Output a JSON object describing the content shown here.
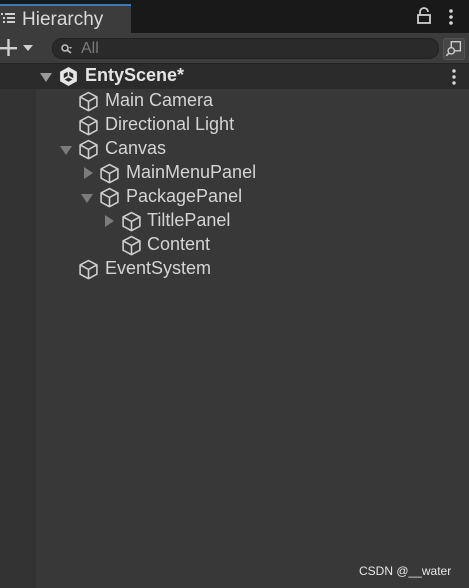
{
  "window": {
    "tab_title": "Hierarchy"
  },
  "toolbar": {
    "search_placeholder": "All"
  },
  "scene": {
    "name": "EntyScene*"
  },
  "tree": {
    "main_camera": "Main Camera",
    "directional_light": "Directional Light",
    "canvas": "Canvas",
    "main_menu_panel": "MainMenuPanel",
    "package_panel": "PackagePanel",
    "tiltle_panel": "TiltlePanel",
    "content": "Content",
    "event_system": "EventSystem"
  },
  "watermark": "CSDN @__water",
  "colors": {
    "accent": "#3a79bb",
    "background": "#383838",
    "text": "#d2d2d2"
  }
}
